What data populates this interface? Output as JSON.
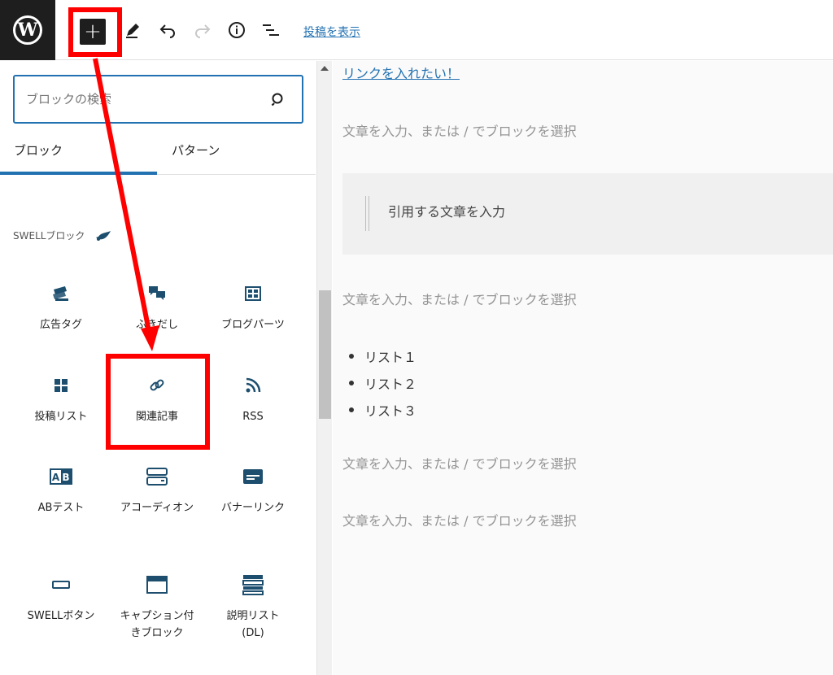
{
  "toolbar": {
    "logo_icon": "wordpress-logo",
    "add_block_label": "+",
    "preview_link": "投稿を表示"
  },
  "sidebar": {
    "search_placeholder": "ブロックの検索",
    "tabs": [
      "ブロック",
      "パターン"
    ],
    "active_tab": "ブロック",
    "category_title": "SWELLブロック",
    "blocks": [
      {
        "label": "広告タグ",
        "icon": "ad-tag-icon"
      },
      {
        "label": "ふきだし",
        "icon": "speech-bubble-icon"
      },
      {
        "label": "ブログパーツ",
        "icon": "blog-parts-icon"
      },
      {
        "label": "投稿リスト",
        "icon": "post-list-icon"
      },
      {
        "label": "関連記事",
        "icon": "link-icon"
      },
      {
        "label": "RSS",
        "icon": "rss-icon"
      },
      {
        "label": "ABテスト",
        "icon": "ab-test-icon"
      },
      {
        "label": "アコーディオン",
        "icon": "accordion-icon"
      },
      {
        "label": "バナーリンク",
        "icon": "banner-link-icon"
      },
      {
        "label": "SWELLボタン",
        "icon": "button-icon"
      },
      {
        "label": "キャプション付きブロック",
        "icon": "caption-block-icon"
      },
      {
        "label": "説明リスト(DL)",
        "icon": "description-list-icon"
      }
    ]
  },
  "editor": {
    "link_text": "リンクを入れたい！",
    "paragraph_placeholder": "文章を入力、または / でブロックを選択",
    "quote_placeholder": "引用する文章を入力",
    "list_items": [
      "リスト１",
      "リスト２",
      "リスト３"
    ]
  },
  "colors": {
    "accent": "#2271b1",
    "annotation": "#ff0000",
    "dark": "#1e1e1e"
  }
}
